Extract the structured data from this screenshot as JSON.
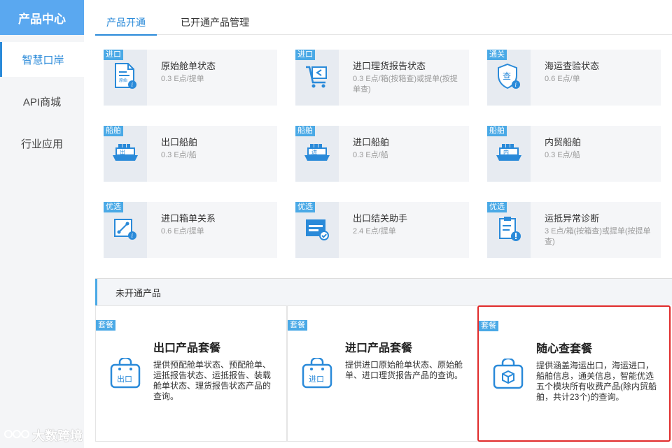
{
  "sidebar": {
    "header": "产品中心",
    "items": [
      {
        "label": "智慧口岸"
      },
      {
        "label": "API商城"
      },
      {
        "label": "行业应用"
      }
    ]
  },
  "tabs": [
    {
      "label": "产品开通"
    },
    {
      "label": "已开通产品管理"
    }
  ],
  "products": [
    {
      "tag": "进口",
      "title": "原始舱单状态",
      "desc": "0.3 E点/提单",
      "icon": "document-info-icon"
    },
    {
      "tag": "进口",
      "title": "进口理货报告状态",
      "desc": "0.3 E点/箱(按箱查)或提单(按提单查)",
      "icon": "cart-report-icon"
    },
    {
      "tag": "通关",
      "title": "海运查验状态",
      "desc": "0.6 E点/单",
      "icon": "shield-inspect-icon"
    },
    {
      "tag": "船舶",
      "title": "出口船舶",
      "desc": "0.3 E点/船",
      "icon": "ship-export-icon"
    },
    {
      "tag": "船舶",
      "title": "进口船舶",
      "desc": "0.3 E点/船",
      "icon": "ship-import-icon"
    },
    {
      "tag": "船舶",
      "title": "内贸船舶",
      "desc": "0.3 E点/船",
      "icon": "ship-domestic-icon"
    },
    {
      "tag": "优选",
      "title": "进口箱单关系",
      "desc": "0.6 E点/提单",
      "icon": "link-info-icon"
    },
    {
      "tag": "优选",
      "title": "出口结关助手",
      "desc": "2.4 E点/提单",
      "icon": "window-check-icon"
    },
    {
      "tag": "优选",
      "title": "运抵异常诊断",
      "desc": "3 E点/箱(按箱查)或提单(按提单查)",
      "icon": "clipboard-alert-icon"
    }
  ],
  "section": {
    "title": "未开通产品"
  },
  "packages": [
    {
      "tag": "套餐",
      "title": "出口产品套餐",
      "desc": "提供预配舱单状态、预配舱单、运抵报告状态、运抵报告、装载舱单状态、理货报告状态产品的查询。",
      "icon_label": "出口"
    },
    {
      "tag": "套餐",
      "title": "进口产品套餐",
      "desc": "提供进口原始舱单状态、原始舱单、进口理货报告产品的查询。",
      "icon_label": "进口"
    },
    {
      "tag": "套餐",
      "title": "随心查套餐",
      "desc": "提供涵盖海运出口，海运进口，船舶信息，通关信息，智能优选五个模块所有收费产品(除内贸船舶，共计23个)的查询。",
      "icon_label": ""
    }
  ],
  "watermark": "大数跨境",
  "colors": {
    "accent": "#2a8ad9",
    "sidebar_header": "#5aa8f0",
    "tag": "#4aa9e6",
    "highlight": "#e02b2b"
  }
}
